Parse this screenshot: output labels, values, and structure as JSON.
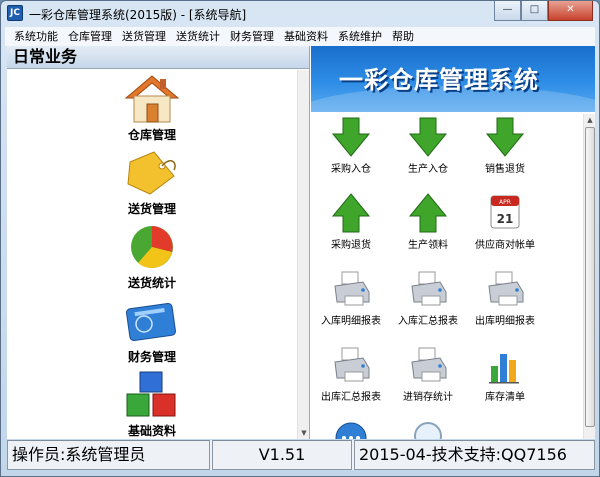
{
  "window": {
    "title": "一彩仓库管理系统(2015版) - [系统导航]",
    "app_icon_text": "JC",
    "min_glyph": "—",
    "max_glyph": "□",
    "close_glyph": "✕"
  },
  "menu": [
    "系统功能",
    "仓库管理",
    "送货管理",
    "送货统计",
    "财务管理",
    "基础资料",
    "系统维护",
    "帮助"
  ],
  "left": {
    "header": "日常业务",
    "items": [
      {
        "label": "仓库管理",
        "icon": "house-icon"
      },
      {
        "label": "送货管理",
        "icon": "tag-icon"
      },
      {
        "label": "送货统计",
        "icon": "pie-chart-icon"
      },
      {
        "label": "财务管理",
        "icon": "card-icon"
      },
      {
        "label": "基础资料",
        "icon": "blocks-icon"
      }
    ]
  },
  "right": {
    "banner": "一彩仓库管理系统",
    "tiles": [
      {
        "label": "采购入仓",
        "icon": "arrow-down-icon"
      },
      {
        "label": "生产入仓",
        "icon": "arrow-down-icon"
      },
      {
        "label": "销售退货",
        "icon": "arrow-down-icon"
      },
      {
        "label": "采购退货",
        "icon": "arrow-up-icon"
      },
      {
        "label": "生产领料",
        "icon": "arrow-up-icon"
      },
      {
        "label": "供应商对帐单",
        "icon": "calendar-icon",
        "cal_month": "APR",
        "cal_day": "21"
      },
      {
        "label": "入库明细报表",
        "icon": "printer-icon"
      },
      {
        "label": "入库汇总报表",
        "icon": "printer-icon"
      },
      {
        "label": "出库明细报表",
        "icon": "printer-icon"
      },
      {
        "label": "出库汇总报表",
        "icon": "printer-icon"
      },
      {
        "label": "进销存统计",
        "icon": "printer-icon"
      },
      {
        "label": "库存清单",
        "icon": "bar-chart-icon"
      },
      {
        "label": "",
        "icon": "chat-icon"
      },
      {
        "label": "",
        "icon": "magnifier-icon"
      }
    ]
  },
  "status": {
    "operator": "操作员:系统管理员",
    "version": "V1.51",
    "date": "2015-04-",
    "support": "技术支持:QQ7156"
  },
  "colors": {
    "arrow_green": "#3fa62b",
    "banner_blue": "#2d8de6"
  }
}
